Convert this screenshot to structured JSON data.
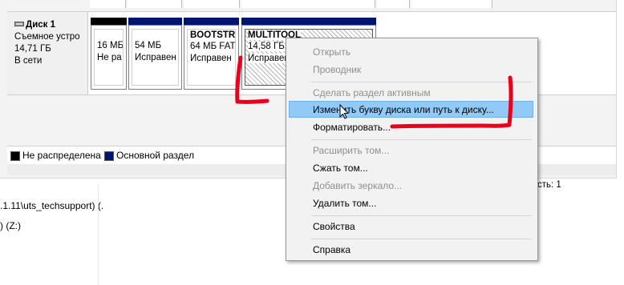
{
  "disk": {
    "name": "Диск 1",
    "type": "Съемное устро",
    "size": "14,71 ГБ",
    "status": "В сети"
  },
  "partitions": [
    {
      "line1": "16 МБ",
      "line2": "Не ра",
      "cap": "black"
    },
    {
      "line1": "54 МБ",
      "line2": "Исправен",
      "cap": "blue"
    },
    {
      "title": "BOOTSTR",
      "line1": "64 МБ FAT",
      "line2": "Исправен",
      "cap": "blue"
    },
    {
      "title": "MULTITOOL",
      "line1": "14,58 ГБ",
      "line2": "Исправен",
      "cap": "blue"
    }
  ],
  "legend": {
    "unallocated": "Не распределена",
    "primary": "Основной раздел"
  },
  "explorer": {
    "network_path": ".1.11\\uts_techsupport) (.",
    "drive": ") (Z:)",
    "status_fragment": "сть: 1"
  },
  "context_menu": {
    "items": [
      {
        "label": "Открыть",
        "enabled": false
      },
      {
        "label": "Проводник",
        "enabled": false
      },
      {
        "label": "Сделать раздел активным",
        "enabled": false
      },
      {
        "label": "Изменить букву диска или путь к диску...",
        "enabled": true,
        "highlighted": true
      },
      {
        "label": "Форматировать...",
        "enabled": true
      },
      {
        "label": "Расширить том...",
        "enabled": false
      },
      {
        "label": "Сжать том...",
        "enabled": true
      },
      {
        "label": "Добавить зеркало...",
        "enabled": false
      },
      {
        "label": "Удалить том...",
        "enabled": true
      },
      {
        "label": "Свойства",
        "enabled": true
      },
      {
        "label": "Справка",
        "enabled": true
      }
    ]
  },
  "colors": {
    "primary_partition": "#00156f",
    "unallocated": "#000000",
    "highlight": "#91c9f7",
    "annotation": "#e8001c"
  },
  "icons": {
    "disk_icon": "removable-disk-icon",
    "cursor": "mouse-cursor-icon"
  }
}
